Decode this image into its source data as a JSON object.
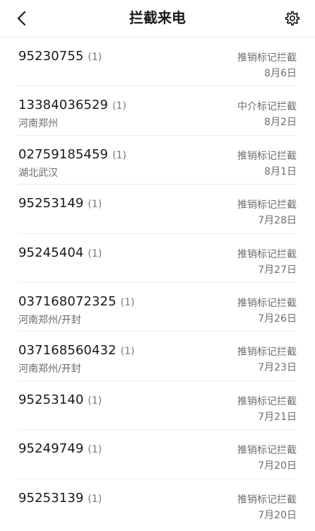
{
  "header": {
    "title": "拦截来电",
    "back_icon": "chevron-left-icon",
    "settings_icon": "gear-icon"
  },
  "calls": [
    {
      "number": "95230755",
      "count": "(1)",
      "location": "",
      "tag": "推销标记拦截",
      "date": "8月6日"
    },
    {
      "number": "13384036529",
      "count": "(1)",
      "location": "河南郑州",
      "tag": "中介标记拦截",
      "date": "8月2日"
    },
    {
      "number": "02759185459",
      "count": "(1)",
      "location": "湖北武汉",
      "tag": "推销标记拦截",
      "date": "8月1日"
    },
    {
      "number": "95253149",
      "count": "(1)",
      "location": "",
      "tag": "推销标记拦截",
      "date": "7月28日"
    },
    {
      "number": "95245404",
      "count": "(1)",
      "location": "",
      "tag": "推销标记拦截",
      "date": "7月27日"
    },
    {
      "number": "037168072325",
      "count": "(1)",
      "location": "河南郑州/开封",
      "tag": "推销标记拦截",
      "date": "7月26日"
    },
    {
      "number": "037168560432",
      "count": "(1)",
      "location": "河南郑州/开封",
      "tag": "推销标记拦截",
      "date": "7月23日"
    },
    {
      "number": "95253140",
      "count": "(1)",
      "location": "",
      "tag": "推销标记拦截",
      "date": "7月21日"
    },
    {
      "number": "95249749",
      "count": "(1)",
      "location": "",
      "tag": "推销标记拦截",
      "date": "7月20日"
    },
    {
      "number": "95253139",
      "count": "(1)",
      "location": "",
      "tag": "推销标记拦截",
      "date": "7月20日"
    }
  ]
}
